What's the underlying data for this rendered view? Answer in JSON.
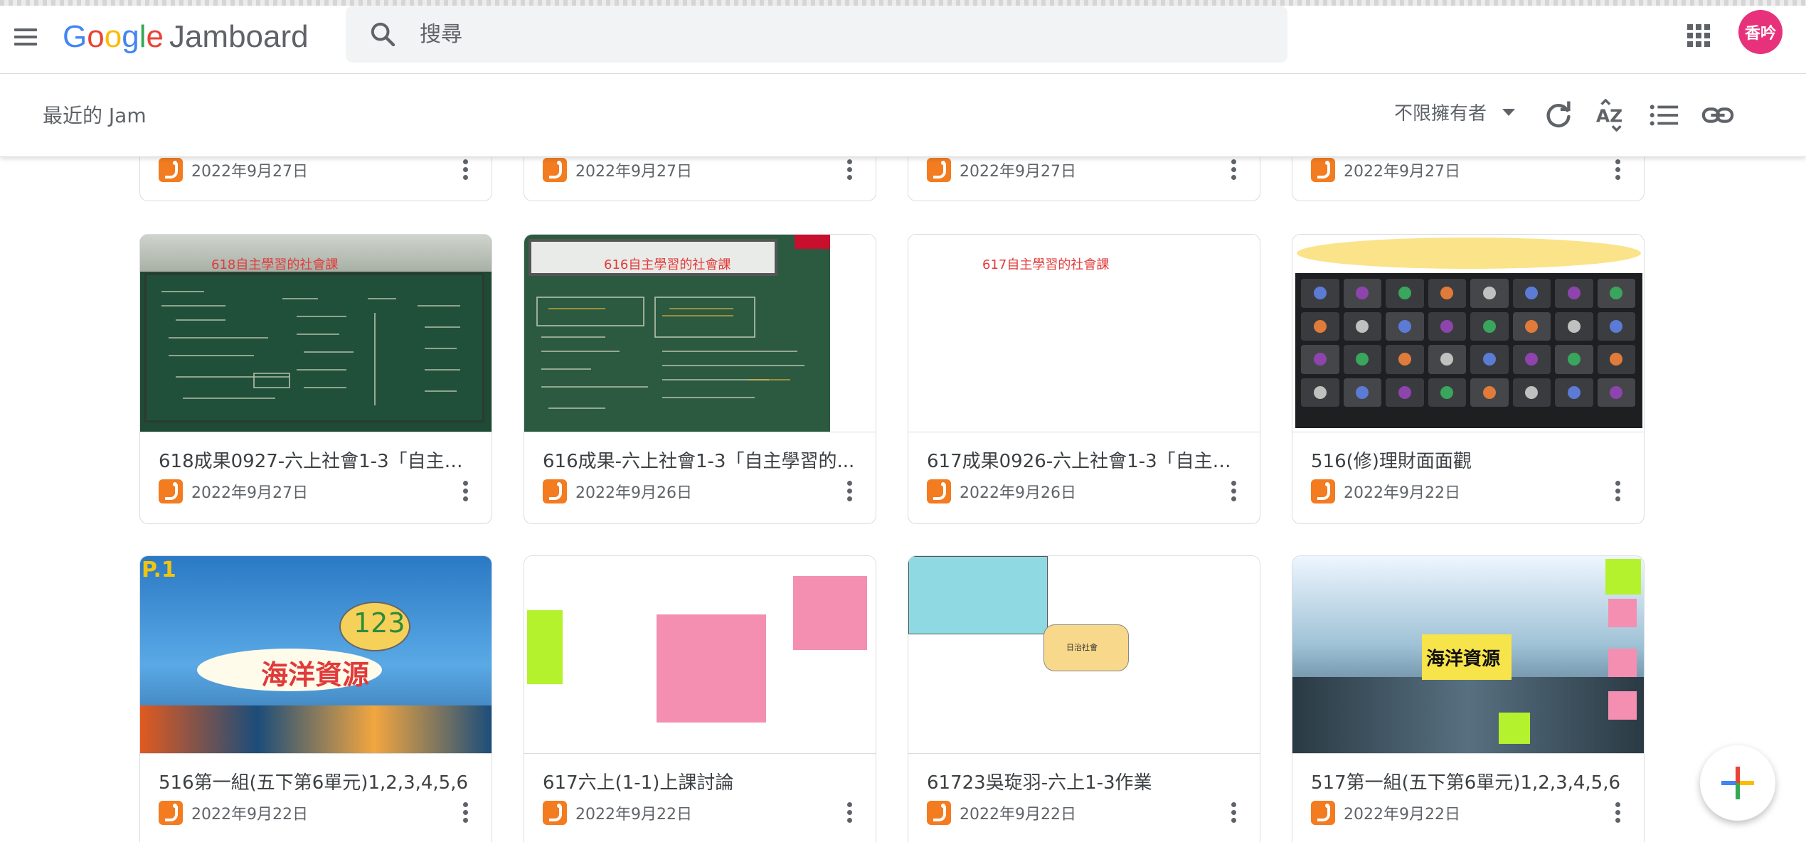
{
  "app": {
    "logo_google": [
      "G",
      "o",
      "o",
      "g",
      "l",
      "e"
    ],
    "product": "Jamboard"
  },
  "search": {
    "placeholder": "搜尋"
  },
  "user": {
    "avatar_text": "香吟"
  },
  "subbar": {
    "title": "最近的 Jam",
    "owner_filter": "不限擁有者"
  },
  "icons": {
    "menu": "menu-icon",
    "search": "search-icon",
    "apps": "apps-grid-icon",
    "refresh": "refresh-icon",
    "sort": "sort-az-icon",
    "list": "list-view-icon",
    "link": "link-icon",
    "new": "plus-icon"
  },
  "colors": {
    "jam_orange": "#f37c20",
    "avatar": "#e8317b"
  },
  "rows": [
    [
      {
        "date": "2022年9月27日"
      },
      {
        "date": "2022年9月27日"
      },
      {
        "date": "2022年9月27日"
      },
      {
        "date": "2022年9月27日"
      }
    ],
    [
      {
        "title": "618成果0927-六上社會1-3「自主學...",
        "date": "2022年9月27日",
        "thumb_caption": "618自主學習的社會課"
      },
      {
        "title": "616成果-六上社會1-3「自主學習的...",
        "date": "2022年9月26日",
        "thumb_caption": "616自主學習的社會課"
      },
      {
        "title": "617成果0926-六上社會1-3「自主學...",
        "date": "2022年9月26日",
        "thumb_caption": "617自主學習的社會課"
      },
      {
        "title": "516(修)理財面面觀",
        "date": "2022年9月22日"
      }
    ],
    [
      {
        "title": "516第一組(五下第6單元)1,2,3,4,5,6",
        "date": "2022年9月22日",
        "thumb_caption": "海洋資源",
        "thumb_number": "123",
        "thumb_page": "P.1"
      },
      {
        "title": "617六上(1-1)上課討論",
        "date": "2022年9月22日"
      },
      {
        "title": "61723吳琁羽-六上1-3作業",
        "date": "2022年9月22日",
        "thumb_caption": "日治社會"
      },
      {
        "title": "517第一組(五下第6單元)1,2,3,4,5,6",
        "date": "2022年9月22日",
        "thumb_caption": "海洋資源"
      }
    ]
  ]
}
